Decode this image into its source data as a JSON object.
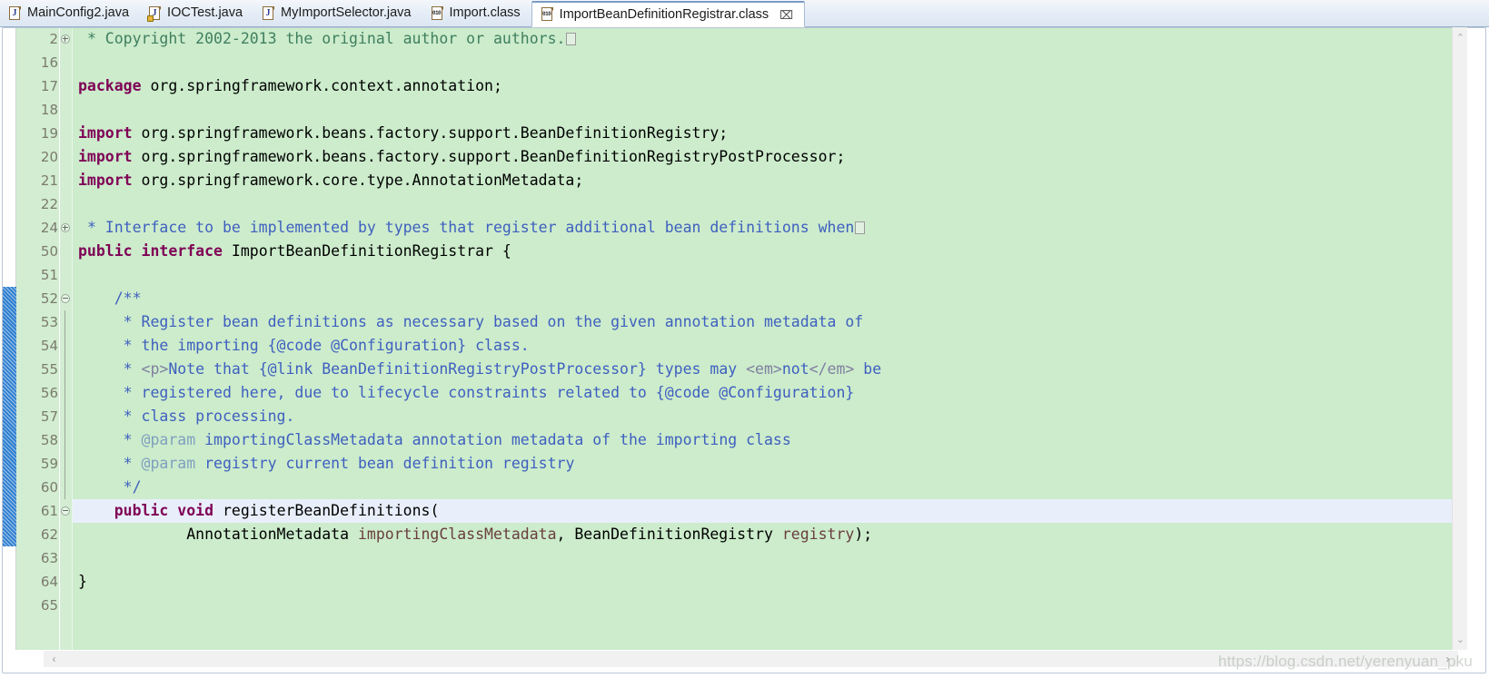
{
  "tabs": [
    {
      "label": "MainConfig2.java",
      "icon": "java-file-icon",
      "active": false,
      "locked": false
    },
    {
      "label": "IOCTest.java",
      "icon": "java-file-icon",
      "active": false,
      "locked": true
    },
    {
      "label": "MyImportSelector.java",
      "icon": "java-file-icon",
      "active": false,
      "locked": false
    },
    {
      "label": "Import.class",
      "icon": "class-file-icon",
      "active": false,
      "locked": false
    },
    {
      "label": "ImportBeanDefinitionRegistrar.class",
      "icon": "class-file-icon",
      "active": true,
      "locked": false
    }
  ],
  "tab_close_glyph": "⌧",
  "editor": {
    "theme": {
      "background": "#cceccc",
      "gutter_background": "#d2edd2",
      "current_line": "#e8effb",
      "keyword": "#7f0055",
      "comment": "#3f7f5f",
      "javadoc": "#3f5fbf",
      "javadoc_tag": "#7f9fbf",
      "javadoc_html": "#7f7f9f",
      "parameter": "#6a3e3e",
      "change_bar": "#2f7fd0"
    },
    "lines": [
      {
        "number": "2",
        "fold": "expand",
        "current": false,
        "tokens": [
          {
            "t": " ",
            "c": "plain"
          },
          {
            "t": "* Copyright 2002-2013 the original author or authors.",
            "c": "cmt"
          },
          {
            "t": "FOLDBOX",
            "c": "foldbox"
          }
        ]
      },
      {
        "number": "16",
        "fold": "",
        "current": false,
        "tokens": []
      },
      {
        "number": "17",
        "fold": "",
        "current": false,
        "tokens": [
          {
            "t": "package",
            "c": "kw"
          },
          {
            "t": " org.springframework.context.annotation;",
            "c": "plain"
          }
        ]
      },
      {
        "number": "18",
        "fold": "",
        "current": false,
        "tokens": []
      },
      {
        "number": "19",
        "fold": "",
        "current": false,
        "tokens": [
          {
            "t": "import",
            "c": "kw"
          },
          {
            "t": " org.springframework.beans.factory.support.BeanDefinitionRegistry;",
            "c": "plain"
          }
        ]
      },
      {
        "number": "20",
        "fold": "",
        "current": false,
        "tokens": [
          {
            "t": "import",
            "c": "kw"
          },
          {
            "t": " org.springframework.beans.factory.support.BeanDefinitionRegistryPostProcessor;",
            "c": "plain"
          }
        ]
      },
      {
        "number": "21",
        "fold": "",
        "current": false,
        "tokens": [
          {
            "t": "import",
            "c": "kw"
          },
          {
            "t": " org.springframework.core.type.AnnotationMetadata;",
            "c": "plain"
          }
        ]
      },
      {
        "number": "22",
        "fold": "",
        "current": false,
        "tokens": []
      },
      {
        "number": "24",
        "fold": "expand",
        "current": false,
        "tokens": [
          {
            "t": " ",
            "c": "plain"
          },
          {
            "t": "* Interface to be implemented by types that register additional bean definitions when",
            "c": "doc"
          },
          {
            "t": "FOLDBOX",
            "c": "foldbox"
          }
        ]
      },
      {
        "number": "50",
        "fold": "",
        "current": false,
        "tokens": [
          {
            "t": "public interface",
            "c": "kw"
          },
          {
            "t": " ImportBeanDefinitionRegistrar {",
            "c": "plain"
          }
        ]
      },
      {
        "number": "51",
        "fold": "",
        "current": false,
        "tokens": []
      },
      {
        "number": "52",
        "fold": "collapse",
        "current": false,
        "tokens": [
          {
            "t": "    /**",
            "c": "doc"
          }
        ]
      },
      {
        "number": "53",
        "fold": "line",
        "current": false,
        "tokens": [
          {
            "t": "     * Register bean definitions as necessary based on the given annotation metadata of",
            "c": "doc"
          }
        ]
      },
      {
        "number": "54",
        "fold": "line",
        "current": false,
        "tokens": [
          {
            "t": "     * the importing {@code @Configuration} class.",
            "c": "doc"
          }
        ]
      },
      {
        "number": "55",
        "fold": "line",
        "current": false,
        "tokens": [
          {
            "t": "     * ",
            "c": "doc"
          },
          {
            "t": "<p>",
            "c": "dochtml"
          },
          {
            "t": "Note that {@link BeanDefinitionRegistryPostProcessor} types may ",
            "c": "doc"
          },
          {
            "t": "<em>",
            "c": "dochtml"
          },
          {
            "t": "not",
            "c": "doc"
          },
          {
            "t": "</em>",
            "c": "dochtml"
          },
          {
            "t": " be",
            "c": "doc"
          }
        ]
      },
      {
        "number": "56",
        "fold": "line",
        "current": false,
        "tokens": [
          {
            "t": "     * registered here, due to lifecycle constraints related to {@code @Configuration}",
            "c": "doc"
          }
        ]
      },
      {
        "number": "57",
        "fold": "line",
        "current": false,
        "tokens": [
          {
            "t": "     * class processing.",
            "c": "doc"
          }
        ]
      },
      {
        "number": "58",
        "fold": "line",
        "current": false,
        "tokens": [
          {
            "t": "     * ",
            "c": "doc"
          },
          {
            "t": "@param",
            "c": "doctag"
          },
          {
            "t": " importingClassMetadata annotation metadata of the importing class",
            "c": "doc"
          }
        ]
      },
      {
        "number": "59",
        "fold": "line",
        "current": false,
        "tokens": [
          {
            "t": "     * ",
            "c": "doc"
          },
          {
            "t": "@param",
            "c": "doctag"
          },
          {
            "t": " registry current bean definition registry",
            "c": "doc"
          }
        ]
      },
      {
        "number": "60",
        "fold": "line",
        "current": false,
        "tokens": [
          {
            "t": "     */",
            "c": "doc"
          }
        ]
      },
      {
        "number": "61",
        "fold": "collapse",
        "current": true,
        "tokens": [
          {
            "t": "    ",
            "c": "plain"
          },
          {
            "t": "public void",
            "c": "kw"
          },
          {
            "t": " registerBeanDefinitions(",
            "c": "plain"
          }
        ]
      },
      {
        "number": "62",
        "fold": "",
        "current": false,
        "tokens": [
          {
            "t": "            AnnotationMetadata ",
            "c": "plain"
          },
          {
            "t": "importingClassMetadata",
            "c": "param"
          },
          {
            "t": ", BeanDefinitionRegistry ",
            "c": "plain"
          },
          {
            "t": "registry",
            "c": "param"
          },
          {
            "t": ");",
            "c": "plain"
          }
        ]
      },
      {
        "number": "63",
        "fold": "",
        "current": false,
        "tokens": []
      },
      {
        "number": "64",
        "fold": "",
        "current": false,
        "tokens": [
          {
            "t": "}",
            "c": "plain"
          }
        ]
      },
      {
        "number": "65",
        "fold": "",
        "current": false,
        "tokens": []
      }
    ]
  },
  "scrollbars": {
    "vertical": {
      "up_glyph": "⌃",
      "down_glyph": "⌄"
    },
    "horizontal": {
      "left_glyph": "‹",
      "right_glyph": "›"
    }
  },
  "watermark": "https://blog.csdn.net/yerenyuan_pku"
}
